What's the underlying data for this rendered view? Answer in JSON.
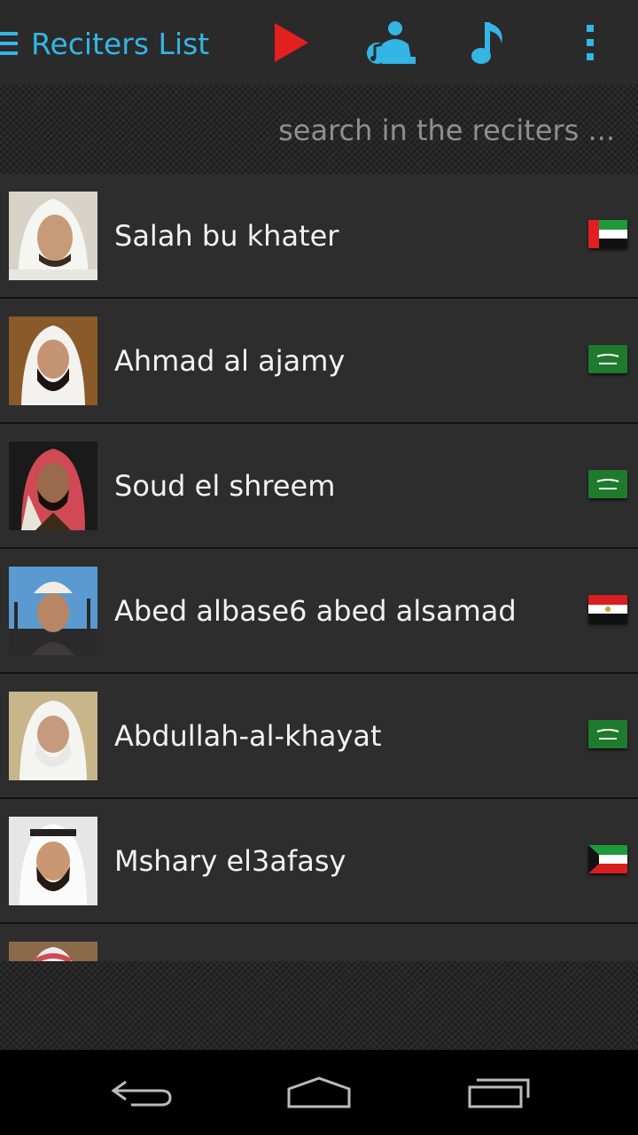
{
  "actionbar": {
    "title": "Reciters List",
    "icons": [
      "menu-icon",
      "play-icon",
      "reciter-icon",
      "music-note-icon",
      "overflow-icon"
    ]
  },
  "search": {
    "placeholder": "search in the reciters ..."
  },
  "reciters": [
    {
      "name": "Salah bu khater",
      "flag": "uae-flag-icon"
    },
    {
      "name": "Ahmad al ajamy",
      "flag": "saudi-flag-icon"
    },
    {
      "name": "Soud el shreem",
      "flag": "saudi-flag-icon"
    },
    {
      "name": "Abed albase6 abed alsamad",
      "flag": "egypt-flag-icon"
    },
    {
      "name": "Abdullah-al-khayat",
      "flag": "saudi-flag-icon"
    },
    {
      "name": "Mshary el3afasy",
      "flag": "kuwait-flag-icon"
    },
    {
      "name": "",
      "flag": ""
    }
  ],
  "colors": {
    "accent": "#33b5e5",
    "play": "#e32020",
    "background": "#2b2b2b"
  },
  "navbar": [
    "back-icon",
    "home-icon",
    "recent-apps-icon"
  ]
}
